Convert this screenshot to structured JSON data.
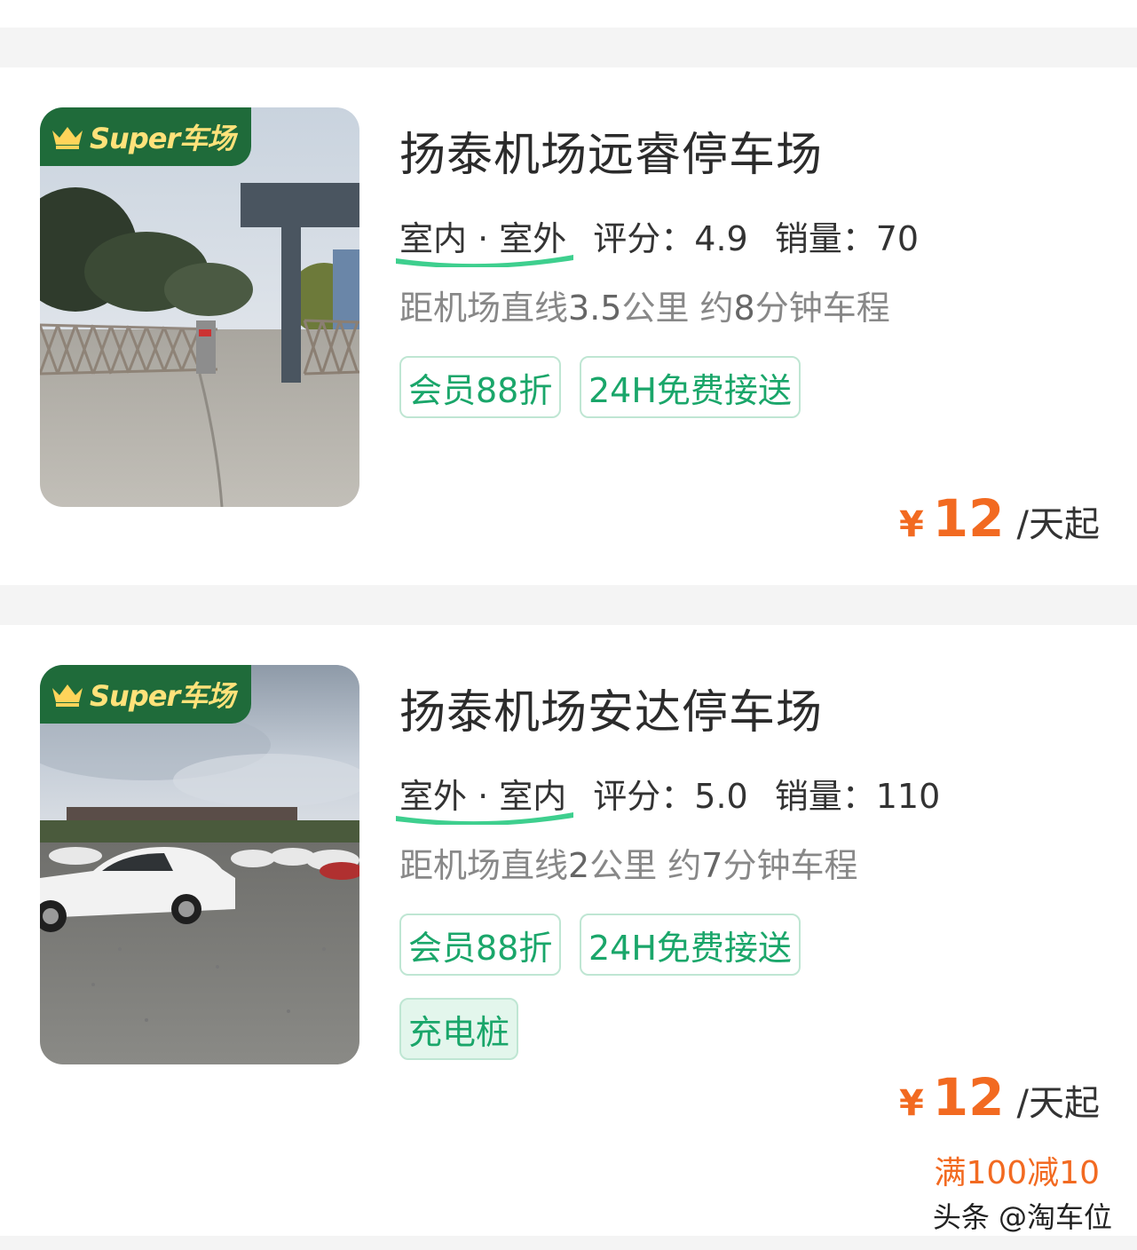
{
  "listings": [
    {
      "badge_text": "Super车场",
      "name": "扬泰机场远睿停车场",
      "env": "室内 · 室外",
      "rating_label": "评分：",
      "rating": "4.9",
      "sales_label": "销量：",
      "sales": "70",
      "distance_prefix": "距机场直线",
      "distance_value": "3.5",
      "distance_mid": "公里 约",
      "time_value": "8",
      "time_suffix": "分钟车程",
      "tags": [
        "会员88折",
        "24H免费接送"
      ],
      "price_symbol": "¥",
      "price": "12",
      "price_unit": "/天起"
    },
    {
      "badge_text": "Super车场",
      "name": "扬泰机场安达停车场",
      "env": "室外 · 室内",
      "rating_label": "评分：",
      "rating": "5.0",
      "sales_label": "销量：",
      "sales": "110",
      "distance_prefix": "距机场直线",
      "distance_value": "2",
      "distance_mid": "公里 约",
      "time_value": "7",
      "time_suffix": "分钟车程",
      "tags": [
        "会员88折",
        "24H免费接送",
        "充电桩"
      ],
      "price_symbol": "¥",
      "price": "12",
      "price_unit": "/天起",
      "promo": "满100减10"
    }
  ],
  "watermark": "头条 @淘车位",
  "colors": {
    "brand_green": "#1f6b3a",
    "tag_green": "#1aa66a",
    "price_orange": "#f26a21"
  },
  "icons": [
    "crown-icon"
  ]
}
